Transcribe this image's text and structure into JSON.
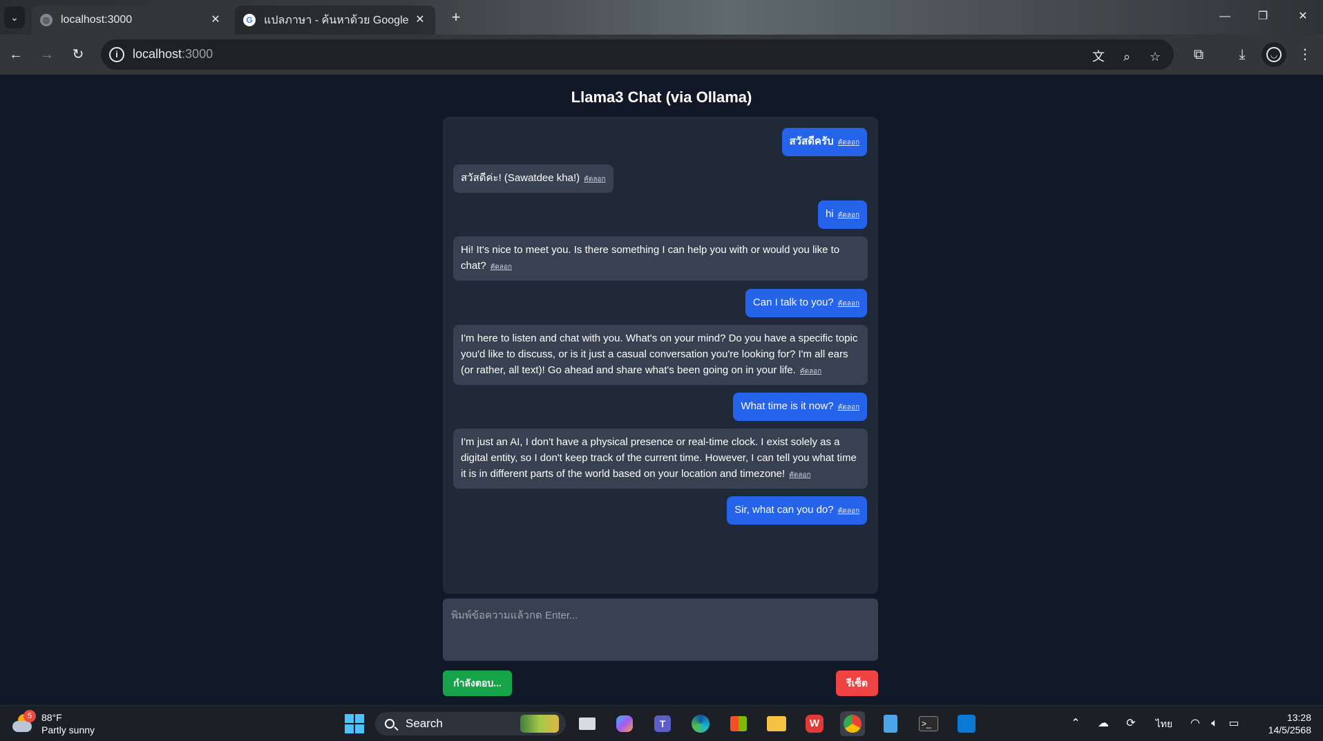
{
  "browser": {
    "tabs": [
      {
        "title": "localhost:3000",
        "active": true
      },
      {
        "title": "แปลภาษา - ค้นหาด้วย Google",
        "active": false
      }
    ],
    "url_host": "localhost",
    "url_port": ":3000"
  },
  "app": {
    "title": "Llama3 Chat (via Ollama)",
    "copy_label": "คัดลอก",
    "messages": [
      {
        "role": "user",
        "text": "สวัสดีครับ"
      },
      {
        "role": "bot",
        "text": "สวัสดีค่ะ! (Sawatdee kha!)"
      },
      {
        "role": "user",
        "text": "hi"
      },
      {
        "role": "bot",
        "text": "Hi! It's nice to meet you. Is there something I can help you with or would you like to chat?"
      },
      {
        "role": "user",
        "text": "Can I talk to you?"
      },
      {
        "role": "bot",
        "text": "I'm here to listen and chat with you. What's on your mind? Do you have a specific topic you'd like to discuss, or is it just a casual conversation you're looking for? I'm all ears (or rather, all text)! Go ahead and share what's been going on in your life."
      },
      {
        "role": "user",
        "text": "What time is it now?"
      },
      {
        "role": "bot",
        "text": "I'm just an AI, I don't have a physical presence or real-time clock. I exist solely as a digital entity, so I don't keep track of the current time. However, I can tell you what time it is in different parts of the world based on your location and timezone!"
      },
      {
        "role": "user",
        "text": "Sir, what can you do?"
      }
    ],
    "input_placeholder": "พิมพ์ข้อความแล้วกด Enter...",
    "send_label": "กำลังตอบ...",
    "reset_label": "รีเซ็ต",
    "colors": {
      "user_bubble": "#2563eb",
      "bot_bubble": "#374151",
      "send": "#16a34a",
      "reset": "#ef4444"
    }
  },
  "taskbar": {
    "weather_temp": "88°F",
    "weather_desc": "Partly sunny",
    "weather_badge": "5",
    "search_label": "Search",
    "language": "ไทย",
    "time": "13:28",
    "date": "14/5/2568"
  }
}
